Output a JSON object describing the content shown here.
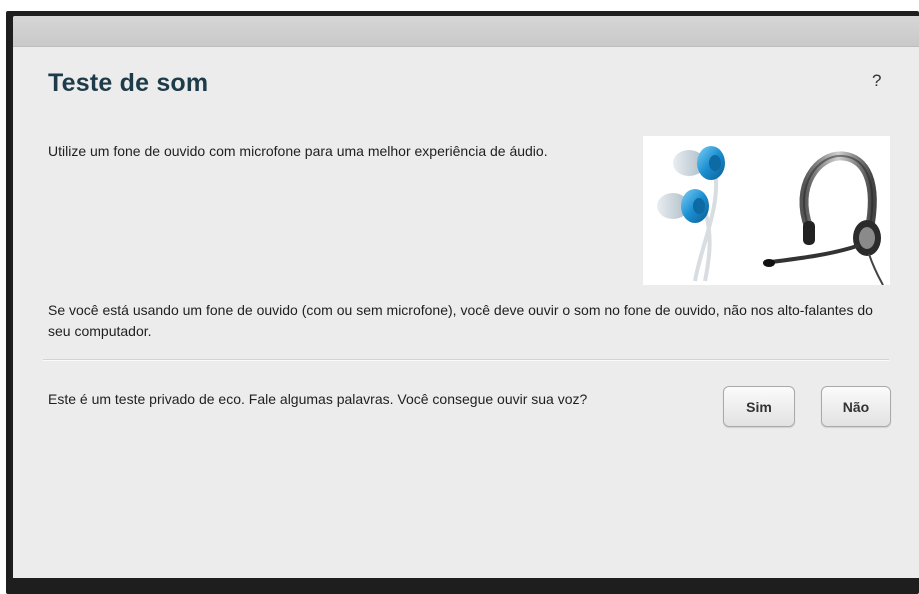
{
  "dialog": {
    "title": "Teste de som",
    "help_label": "?",
    "intro_text": "Utilize um fone de ouvido com microfone para uma melhor experiência de áudio.",
    "headset_text": "Se você está usando um fone de ouvido (com ou sem microfone), você deve ouvir o som no fone de ouvido, não nos alto-falantes do seu computador.",
    "echo_text": "Este é um teste privado de eco. Fale algumas palavras. Você consegue ouvir sua voz?",
    "buttons": {
      "yes_label": "Sim",
      "no_label": "Não"
    },
    "image_icon": "earbuds-and-headset-icon"
  },
  "colors": {
    "title": "#1d3b48",
    "earbud_accent": "#1b8fd1",
    "background": "#ececec"
  }
}
